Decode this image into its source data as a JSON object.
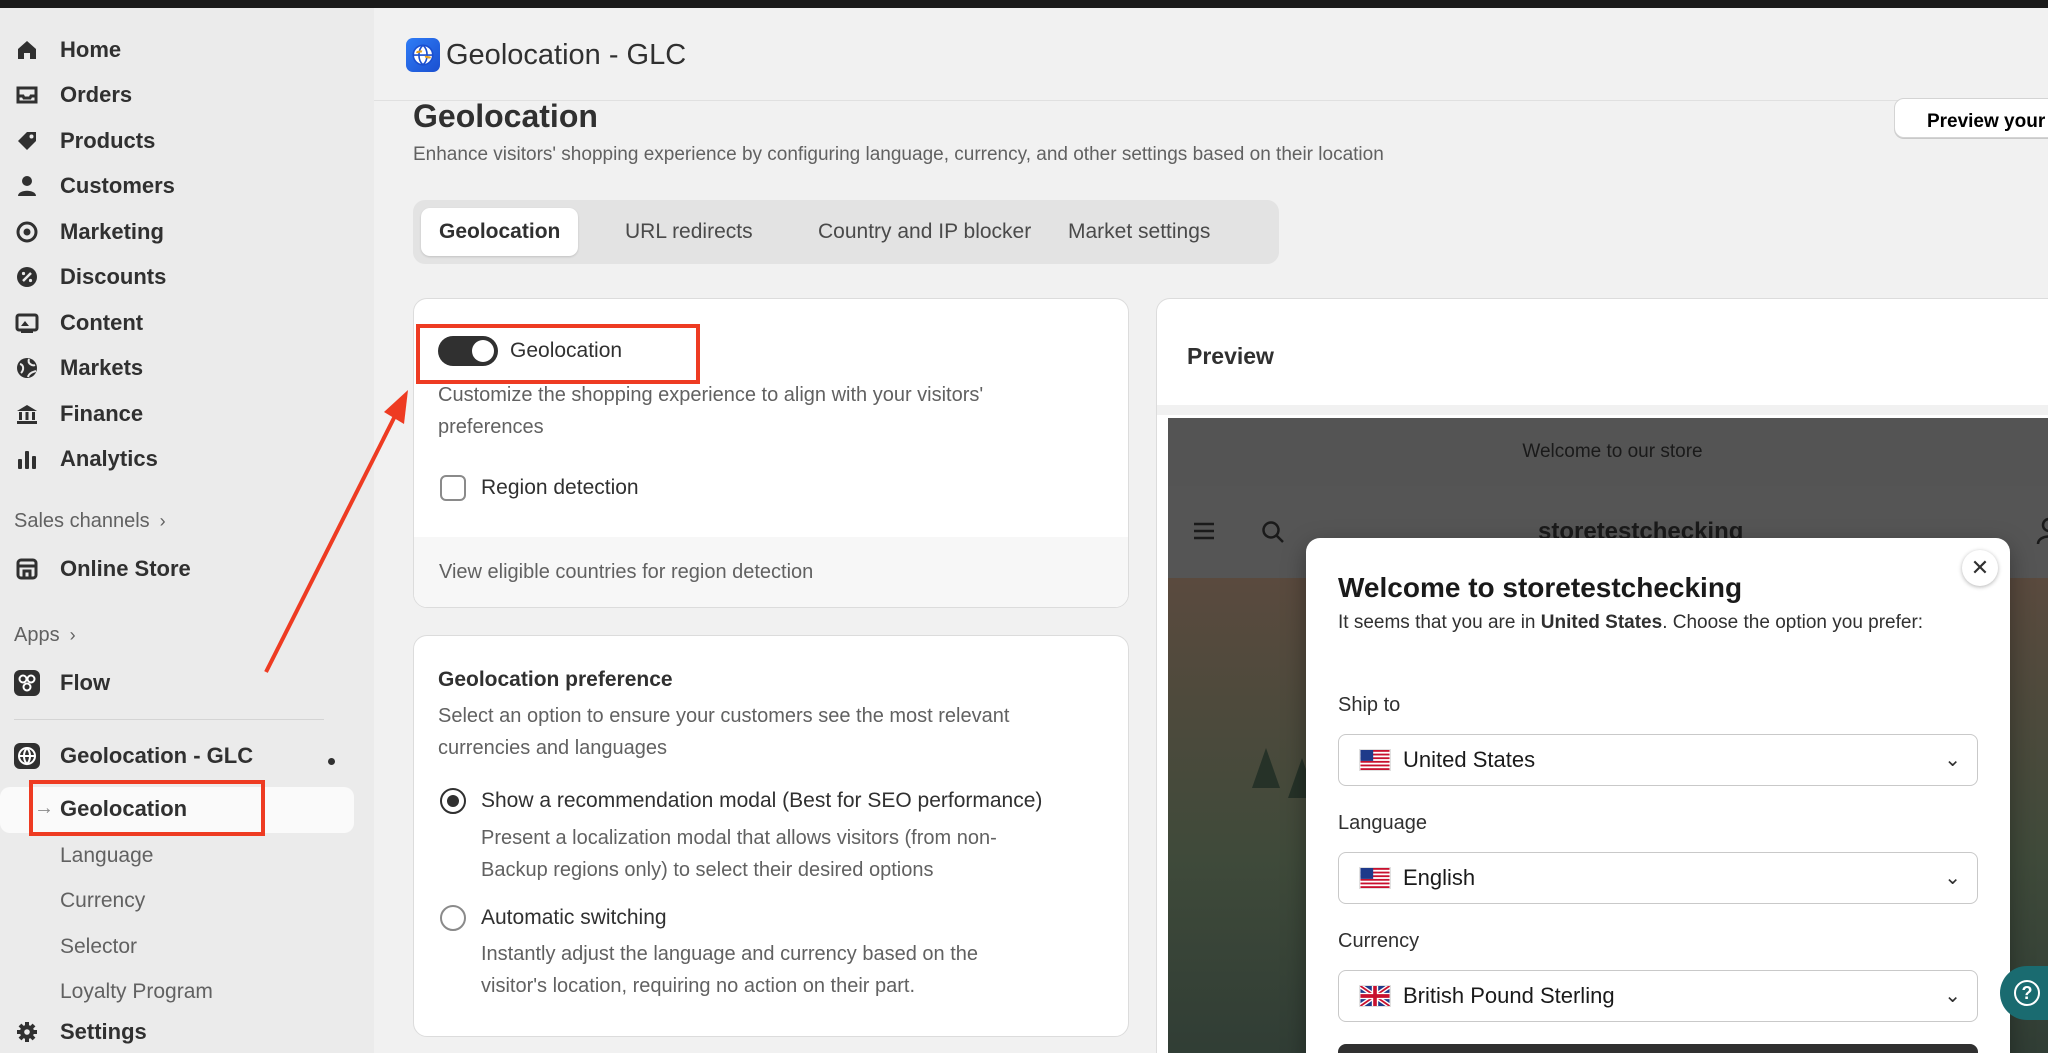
{
  "sidebar": {
    "items": [
      {
        "label": "Home",
        "icon": "home-icon"
      },
      {
        "label": "Orders",
        "icon": "inbox-icon"
      },
      {
        "label": "Products",
        "icon": "tag-icon"
      },
      {
        "label": "Customers",
        "icon": "person-icon"
      },
      {
        "label": "Marketing",
        "icon": "target-icon"
      },
      {
        "label": "Discounts",
        "icon": "discount-icon"
      },
      {
        "label": "Content",
        "icon": "image-icon"
      },
      {
        "label": "Markets",
        "icon": "globe-icon"
      },
      {
        "label": "Finance",
        "icon": "bank-icon"
      },
      {
        "label": "Analytics",
        "icon": "bar-chart-icon"
      }
    ],
    "sales_channels_label": "Sales channels",
    "online_store": "Online Store",
    "apps_label": "Apps",
    "flow": "Flow",
    "app_name": "Geolocation - GLC",
    "sub_items": {
      "active": "Geolocation",
      "language": "Language",
      "currency": "Currency",
      "selector": "Selector",
      "loyalty": "Loyalty Program"
    },
    "settings": "Settings"
  },
  "header": {
    "app_title": "Geolocation - GLC"
  },
  "page": {
    "title": "Geolocation",
    "subtitle": "Enhance visitors' shopping experience by configuring language, currency, and other settings based on their location",
    "preview_button": "Preview your s"
  },
  "tabs": [
    {
      "label": "Geolocation",
      "active": true
    },
    {
      "label": "URL redirects",
      "active": false
    },
    {
      "label": "Country and IP blocker",
      "active": false
    },
    {
      "label": "Market settings",
      "active": false
    }
  ],
  "geolocation_card": {
    "toggle_label": "Geolocation",
    "toggle_on": true,
    "description_line1": "Customize the shopping experience to align with your visitors'",
    "description_line2": "preferences",
    "region_detection_label": "Region detection",
    "region_detection_checked": false,
    "footer_link": "View eligible countries for region detection"
  },
  "preference_card": {
    "title": "Geolocation preference",
    "description_line1": "Select an option to ensure your customers see the most relevant",
    "description_line2": "currencies and languages",
    "option1_label": "Show a recommendation modal (Best for SEO performance)",
    "option1_desc_line1": "Present a localization modal that allows visitors (from non-",
    "option1_desc_line2": "Backup regions only) to select their desired options",
    "option2_label": "Automatic switching",
    "option2_desc_line1": "Instantly adjust the language and currency based on the",
    "option2_desc_line2": "visitor's location, requiring no action on their part.",
    "selected": "option1"
  },
  "preview": {
    "title": "Preview",
    "announcement": "Welcome to our store",
    "store_name": "storetestchecking",
    "modal": {
      "title": "Welcome to storetestchecking",
      "text_before": "It seems that you are in ",
      "text_country": "United States",
      "text_after": ". Choose the option you prefer:",
      "ship_to_label": "Ship to",
      "ship_to_value": "United States",
      "language_label": "Language",
      "language_value": "English",
      "currency_label": "Currency",
      "currency_value": "British Pound Sterling"
    }
  },
  "colors": {
    "annotation": "#ee3b22",
    "toggle_on": "#303030",
    "help_button": "#1a6b70"
  }
}
